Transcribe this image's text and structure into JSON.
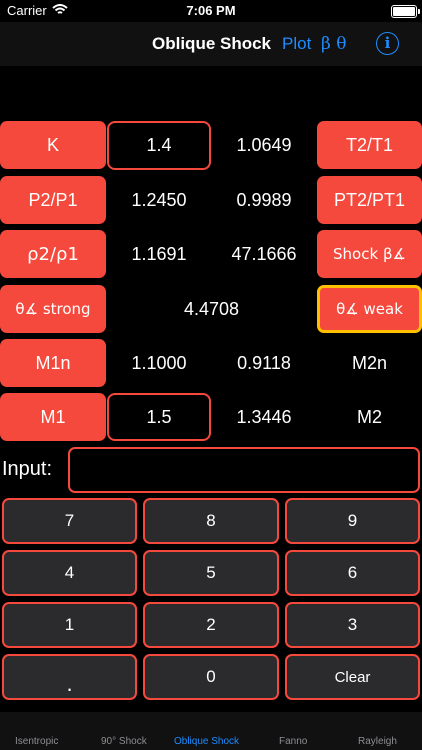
{
  "status": {
    "carrier": "Carrier",
    "time": "7:06 PM"
  },
  "nav": {
    "title": "Oblique Shock",
    "plot": "Plot",
    "beta_theta": "β θ"
  },
  "grid": {
    "k_label": "K",
    "k_value": "1.4",
    "t_ratio_value": "1.0649",
    "t_ratio_label": "T2/T1",
    "p_ratio_label": "P2/P1",
    "p_ratio_value": "1.2450",
    "pt_ratio_value": "0.9989",
    "pt_ratio_label": "PT2/PT1",
    "rho_ratio_label": "ρ2/ρ1",
    "rho_ratio_value": "1.1691",
    "shock_beta_value": "47.1666",
    "shock_beta_label": "Shock β∡",
    "theta_strong_label": "θ∡ strong",
    "theta_value": "4.4708",
    "theta_weak_label": "θ∡ weak",
    "m1n_label": "M1n",
    "m1n_value": "1.1000",
    "m2n_value": "0.9118",
    "m2n_label": "M2n",
    "m1_label": "M1",
    "m1_value": "1.5",
    "m2_value": "1.3446",
    "m2_label": "M2"
  },
  "input": {
    "label": "Input:",
    "value": ""
  },
  "keypad": {
    "k7": "7",
    "k8": "8",
    "k9": "9",
    "k4": "4",
    "k5": "5",
    "k6": "6",
    "k1": "1",
    "k2": "2",
    "k3": "3",
    "kdot": ".",
    "k0": "0",
    "kclear": "Clear"
  },
  "tabs": {
    "isentropic": "Isentropic",
    "shock90": "90° Shock",
    "oblique": "Oblique Shock",
    "fanno": "Fanno",
    "rayleigh": "Rayleigh"
  },
  "colors": {
    "accent_red": "#f4493c",
    "link_blue": "#1e8cff",
    "highlight": "#ffc000"
  }
}
